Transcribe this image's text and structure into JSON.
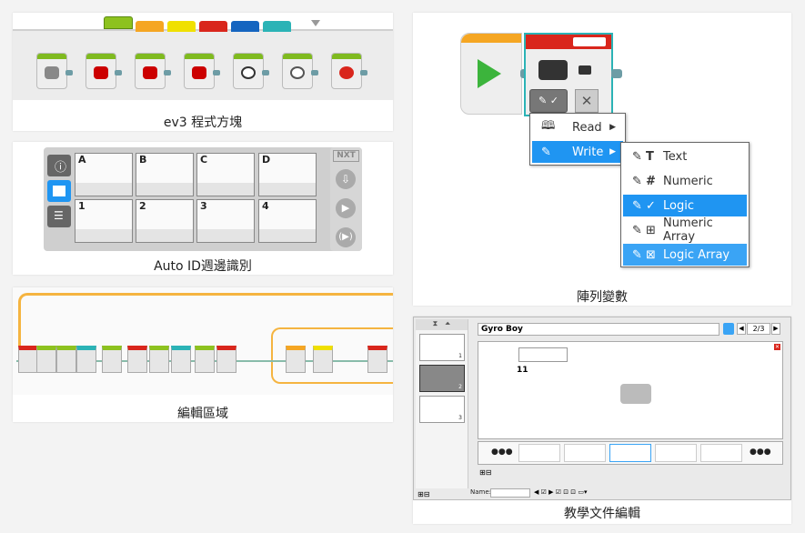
{
  "captions": {
    "palette": "ev3 程式方塊",
    "portview": "Auto ID週邊識別",
    "canvas": "編輯區域",
    "array": "陣列變數",
    "content_editor": "教學文件編輯"
  },
  "palette_tab_colors": [
    "#8dc21f",
    "#f5a623",
    "#f0e000",
    "#d9261c",
    "#1565c0",
    "#2bb3b6"
  ],
  "portview": {
    "logo": "NXT",
    "motor_ports": [
      "A",
      "B",
      "C",
      "D"
    ],
    "sensor_ports": [
      "1",
      "2",
      "3",
      "4"
    ]
  },
  "array_menu": {
    "main": [
      {
        "label": "Read",
        "icon": "book-icon"
      },
      {
        "label": "Write",
        "icon": "pencil-icon"
      }
    ],
    "sub": [
      {
        "label": "Text",
        "icon": "text-T-icon"
      },
      {
        "label": "Numeric",
        "icon": "hash-icon"
      },
      {
        "label": "Logic",
        "icon": "logic-check-icon"
      },
      {
        "label": "Numeric Array",
        "icon": "numeric-array-icon"
      },
      {
        "label": "Logic Array",
        "icon": "logic-array-icon"
      }
    ]
  },
  "content_editor": {
    "title": "Gyro Boy",
    "page": "2/3",
    "step_number": "11",
    "name_label": "Name:",
    "more": "●●●",
    "thumbs": [
      "1",
      "2",
      "3"
    ]
  },
  "colors": {
    "accent": "#1f95f2",
    "start_green": "#3cb43c",
    "teal": "#2bb3b6"
  }
}
